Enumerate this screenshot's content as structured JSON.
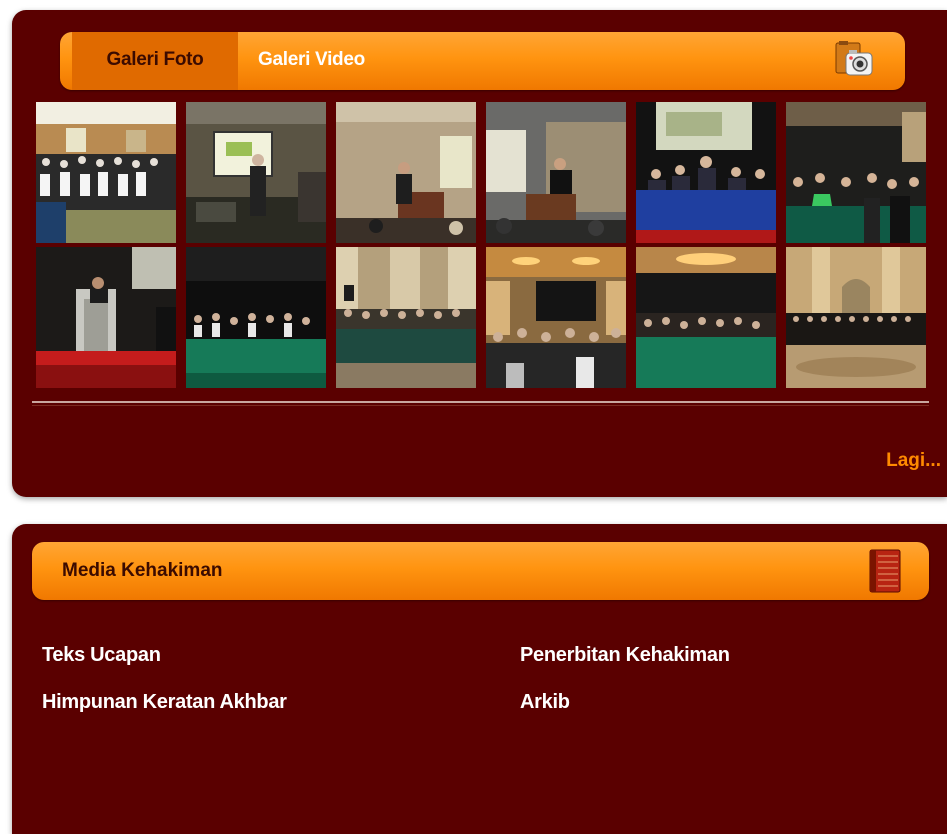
{
  "gallery": {
    "tabs": [
      {
        "label": "Galeri Foto",
        "active": true
      },
      {
        "label": "Galeri Video",
        "active": false
      }
    ],
    "icon": "camera-icon",
    "photos": [
      {
        "name": "photo-1",
        "theme": "conference-room"
      },
      {
        "name": "photo-2",
        "theme": "speaker-screen"
      },
      {
        "name": "photo-3",
        "theme": "podium-screen"
      },
      {
        "name": "photo-4",
        "theme": "podium-speaker"
      },
      {
        "name": "photo-5",
        "theme": "panel-table"
      },
      {
        "name": "photo-6",
        "theme": "audience"
      },
      {
        "name": "photo-7",
        "theme": "podium-red-carpet"
      },
      {
        "name": "photo-8",
        "theme": "audience-tables"
      },
      {
        "name": "photo-9",
        "theme": "hall-audience"
      },
      {
        "name": "photo-10",
        "theme": "ballroom-audience"
      },
      {
        "name": "photo-11",
        "theme": "ballroom-tables"
      },
      {
        "name": "photo-12",
        "theme": "grand-hall"
      }
    ],
    "more_label": "Lagi..."
  },
  "media": {
    "title": "Media Kehakiman",
    "icon": "book-icon",
    "links": [
      {
        "label": "Teks Ucapan"
      },
      {
        "label": "Penerbitan Kehakiman"
      },
      {
        "label": "Himpunan Keratan Akhbar"
      },
      {
        "label": "Arkib"
      }
    ]
  },
  "colors": {
    "panel_bg": "#5a0000",
    "header_orange": "#ff9410",
    "active_tab": "#e06a00",
    "link_orange": "#ff8a00"
  }
}
